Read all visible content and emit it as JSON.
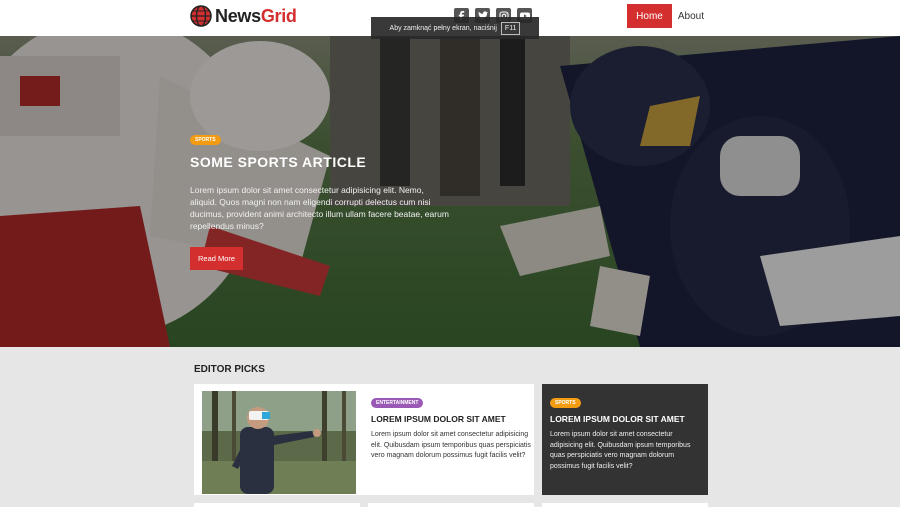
{
  "header": {
    "logo_prefix": "News",
    "logo_accent": "Grid",
    "socials": [
      "facebook-icon",
      "twitter-icon",
      "instagram-icon",
      "youtube-icon"
    ],
    "nav": [
      {
        "label": "Home",
        "active": true
      },
      {
        "label": "About",
        "active": false
      }
    ]
  },
  "fullscreen_notice": {
    "text": "Aby zamknąć pełny ekran, naciśnij",
    "key": "F11"
  },
  "hero": {
    "badge": "SPORTS",
    "title": "SOME SPORTS ARTICLE",
    "text": "Lorem ipsum dolor sit amet consectetur adipisicing elit. Nemo, aliquid. Quos magni non nam eligendi corrupti delectus cum nisi ducimus, provident animi architecto illum ullam facere beatae, earum repellendus minus?",
    "button": "Read More"
  },
  "editor_picks": {
    "title": "EDITOR PICKS",
    "cards": [
      {
        "badge": "ENTERTAINMENT",
        "title": "LOREM IPSUM DOLOR SIT AMET",
        "text": "Lorem ipsum dolor sit amet consectetur adipisicing elit. Quibusdam ipsum temporibus quas perspiciatis vero magnam dolorum possimus fugit facilis velit?"
      },
      {
        "badge": "SPORTS",
        "title": "LOREM IPSUM DOLOR SIT AMET",
        "text": "Lorem ipsum dolor sit amet consectetur adipisicing elit. Quibusdam ipsum temporibus quas perspiciatis vero magnam dolorum possimus fugit facilis velit?"
      }
    ]
  },
  "colors": {
    "brand": "#d32f2f",
    "sports_badge": "#f39c12",
    "entertainment_badge": "#9b59b6",
    "dark_card": "#333333"
  }
}
